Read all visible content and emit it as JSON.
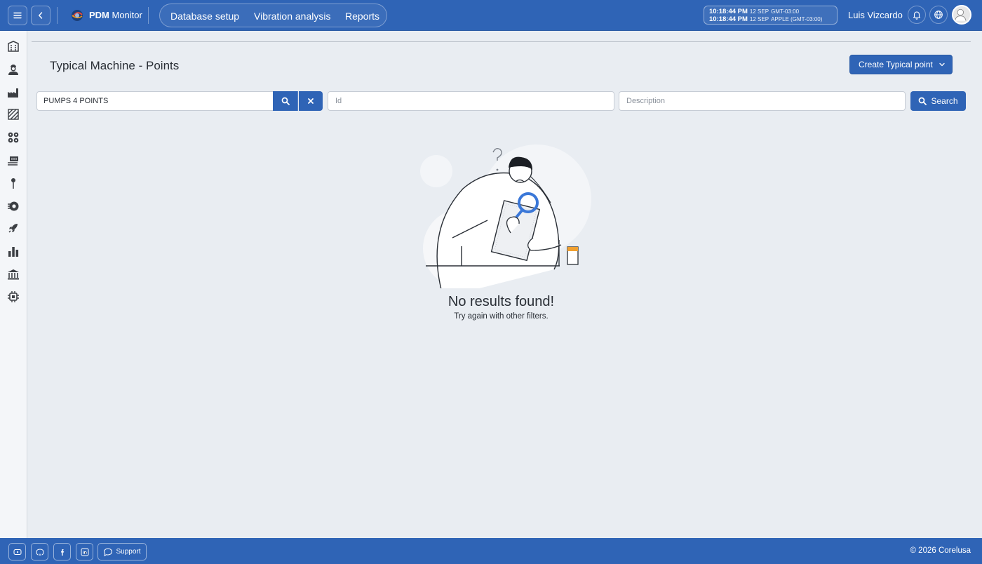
{
  "header": {
    "brand_bold": "PDM",
    "brand_rest": " Monitor",
    "nav": [
      {
        "label": "Database setup"
      },
      {
        "label": "Vibration analysis"
      },
      {
        "label": "Reports"
      }
    ],
    "clock": {
      "row1_time": "10:18:44 PM",
      "row1_date": "12 SEP",
      "row1_zone": "GMT-03:00",
      "row2_time": "10:18:44 PM",
      "row2_date": "12 SEP",
      "row2_zone": "APPLE (GMT-03:00)"
    },
    "user_name": "Luis Vizcardo"
  },
  "sidebar": {
    "icons": [
      "building-icon",
      "engineer-icon",
      "factory-icon",
      "area-hatch-icon",
      "gears-icon",
      "conveyor-icon",
      "pin-icon",
      "gear-speed-icon",
      "rocket-icon",
      "bar-chart-icon",
      "bank-icon",
      "chip-icon"
    ]
  },
  "main": {
    "page_title": "Typical Machine - Points",
    "create_button": "Create Typical point",
    "machine_filter_value": "PUMPS 4 POINTS",
    "id_placeholder": "Id",
    "description_placeholder": "Description",
    "search_button": "Search",
    "empty_title": "No results found!",
    "empty_subtitle": "Try again with other filters."
  },
  "footer": {
    "support_label": "Support",
    "copyright": "© 2026 Corelusa"
  },
  "colors": {
    "primary": "#2f64b6",
    "background": "#e9edf2",
    "magnifier": "#3b78d8",
    "cup": "#f0a030"
  }
}
